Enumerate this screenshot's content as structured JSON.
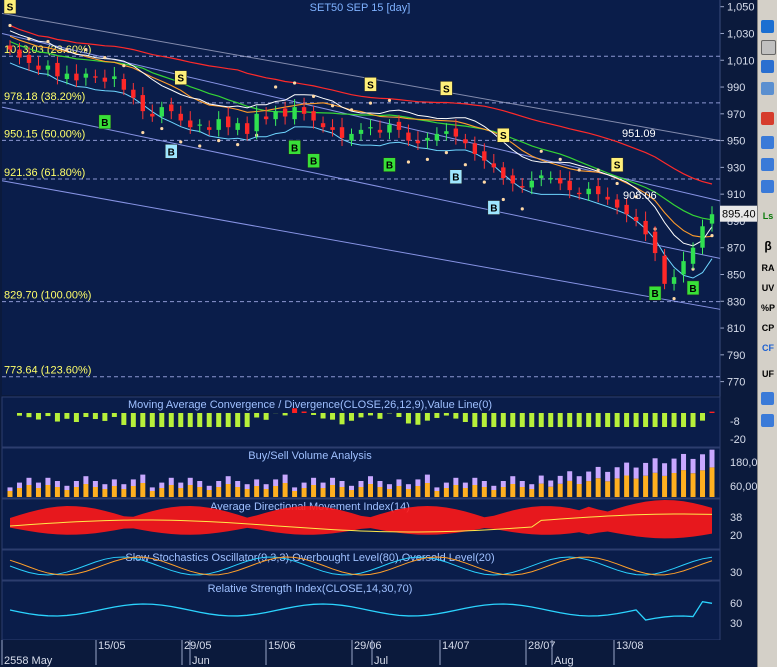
{
  "chart_data": [
    {
      "type": "candlestick",
      "title": "SET50 SEP 15   [day]",
      "x_ticks": [
        "2558 May",
        "15/05",
        "29/05",
        "Jun",
        "15/06",
        "29/06",
        "Jul",
        "14/07",
        "28/07",
        "Aug",
        "13/08"
      ],
      "y_ticks": [
        "1,050",
        "1,030",
        "1,010",
        "990",
        "970",
        "950",
        "930",
        "910",
        "890",
        "870",
        "850",
        "830",
        "810",
        "790",
        "770"
      ],
      "ylim": [
        760,
        1055
      ],
      "last_price": "895.40",
      "close": [
        1018,
        1012,
        1008,
        1003,
        1006,
        998,
        1000,
        995,
        1000,
        997,
        994,
        998,
        988,
        982,
        972,
        968,
        975,
        972,
        965,
        960,
        962,
        958,
        966,
        960,
        963,
        955,
        970,
        966,
        972,
        968,
        975,
        970,
        965,
        960,
        958,
        952,
        955,
        958,
        960,
        956,
        962,
        958,
        950,
        948,
        952,
        955,
        957,
        953,
        948,
        940,
        935,
        930,
        922,
        918,
        915,
        920,
        924,
        922,
        918,
        913,
        910,
        914,
        910,
        906,
        900,
        895,
        890,
        880,
        866,
        843,
        848,
        860,
        870,
        886,
        895
      ],
      "fib_levels": [
        {
          "label": "1013.03 (23.60%)",
          "value": 1013.03
        },
        {
          "label": "978.18 (38.20%)",
          "value": 978.18
        },
        {
          "label": "950.15 (50.00%)",
          "value": 950.15
        },
        {
          "label": "921.36 (61.80%)",
          "value": 921.36
        },
        {
          "label": "829.70 (100.00%)",
          "value": 829.7
        },
        {
          "label": "773.64 (123.60%)",
          "value": 773.64
        }
      ],
      "annotations": [
        {
          "label": "951.09",
          "value": 951.09
        },
        {
          "label": "908.06",
          "value": 908.06
        }
      ],
      "sell_signals": [
        0,
        18,
        38,
        46,
        52,
        64,
        82,
        93
      ],
      "buy_signals": [
        10,
        17,
        30,
        32,
        40,
        47,
        51,
        68,
        72,
        79,
        83,
        87
      ],
      "marker_labels": {
        "sell": "S",
        "buy": "B"
      }
    },
    {
      "type": "bar",
      "title": "Moving Average Convergence / Divergence(CLOSE,26,12,9),Value Line(0)",
      "y_ticks": [
        "-8",
        "-20"
      ]
    },
    {
      "type": "bar",
      "title": "Buy/Sell Volume Analysis",
      "y_ticks": [
        "180,000",
        "60,000"
      ]
    },
    {
      "type": "area",
      "title": "Average Directional Movement Index(14)",
      "y_ticks": [
        "38",
        "20"
      ]
    },
    {
      "type": "line",
      "title": "Slow Stochastics Oscillator(9,3,3),Overbought Level(80),Oversold Level(20)",
      "y_ticks": [
        "30"
      ]
    },
    {
      "type": "line",
      "title": "Relative Strength Index(CLOSE,14,30,70)",
      "y_ticks": [
        "60",
        "30"
      ]
    }
  ],
  "toolbar": {
    "labels": [
      "Ls",
      "β",
      "RA",
      "UV",
      "%P",
      "CP",
      "CF",
      "UF"
    ]
  }
}
